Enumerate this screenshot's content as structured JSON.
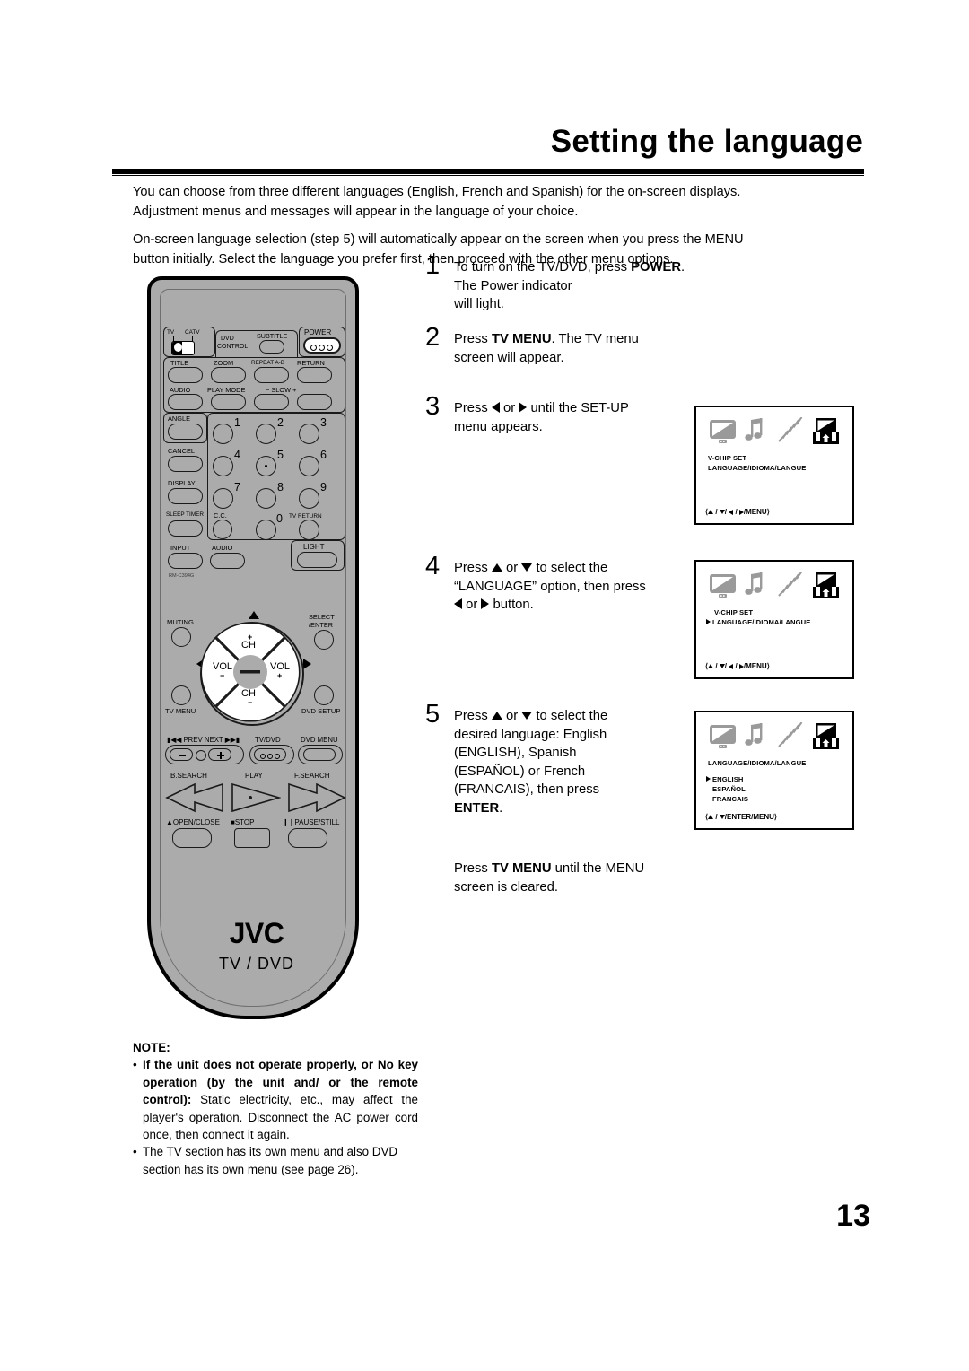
{
  "header": {
    "title": "Setting the language"
  },
  "intro": {
    "p1": "You can choose from three different languages (English, French and Spanish) for the on-screen displays.",
    "p2": "Adjustment menus and messages will appear in the language of your choice.",
    "p3": "On-screen language selection (step 5) will automatically appear on the screen when you press the MENU",
    "p4": "button initially. Select the language you prefer first, then proceed with the other menu options."
  },
  "steps": [
    {
      "num": "1",
      "t1": "To turn on the TV/DVD, press ",
      "b1": "POWER",
      "t2": ". The Power indicator",
      "t3": "will light."
    },
    {
      "num": "2",
      "t1": "Press ",
      "b1": "TV MENU",
      "t2": ". The TV menu",
      "t3": "screen will appear."
    },
    {
      "num": "3",
      "t1": "Press ",
      "t2": " or ",
      "t3": " until the SET-UP",
      "t4": "menu appears."
    },
    {
      "num": "4",
      "t1": "Press ",
      "t2": " or ",
      "t3": " to select the",
      "t4": "“LANGUAGE” option, then press",
      "t5": " or ",
      "t6": " button."
    },
    {
      "num": "5",
      "t1": "Press ",
      "t2": " or ",
      "t3": " to select the",
      "t4": "desired language: English",
      "t5": "(ENGLISH), Spanish",
      "t6": "(ESPAÑOL) or French",
      "t7": "(FRANCAIS), then press",
      "b1": "ENTER",
      "t8": "."
    }
  ],
  "closing": {
    "t1": "Press ",
    "b1": "TV MENU",
    "t2": " until the MENU",
    "t3": "screen is cleared."
  },
  "osd_screens": [
    {
      "id": "osd-setup-menu",
      "icons": [
        "tv-icon",
        "music-note-icon",
        "antenna-icon",
        "setup-box-icon"
      ],
      "lines": [
        {
          "text": "V-CHIP SET",
          "cursor": false
        },
        {
          "text": "LANGUAGE/IDIOMA/LANGUE",
          "cursor": false
        }
      ],
      "footer": "⟨▲ / ▼/ ◀ / ▶/MENU⟩",
      "footer_keys": [
        "up",
        "down",
        "left",
        "right",
        "MENU"
      ]
    },
    {
      "id": "osd-language-highlighted",
      "icons": [
        "tv-icon",
        "music-note-icon",
        "antenna-icon",
        "setup-box-icon"
      ],
      "lines": [
        {
          "text": "V-CHIP SET",
          "cursor": false
        },
        {
          "text": "LANGUAGE/IDIOMA/LANGUE",
          "cursor": true
        }
      ],
      "footer": "⟨▲ / ▼/ ◀ / ▶/MENU⟩",
      "footer_keys": [
        "up",
        "down",
        "left",
        "right",
        "MENU"
      ]
    },
    {
      "id": "osd-language-options",
      "icons": [
        "tv-icon",
        "music-note-icon",
        "antenna-icon",
        "setup-box-icon"
      ],
      "title": "LANGUAGE/IDIOMA/LANGUE",
      "options": [
        {
          "text": "ENGLISH",
          "cursor": true
        },
        {
          "text": "ESPAÑOL",
          "cursor": false
        },
        {
          "text": "FRANCAIS",
          "cursor": false
        }
      ],
      "footer": "⟨▲ / ▼/ENTER/MENU⟩",
      "footer_keys": [
        "up",
        "down",
        "ENTER",
        "MENU"
      ]
    }
  ],
  "remote": {
    "brand": "JVC",
    "subtitle": "TV / DVD",
    "model": "RM-C394G",
    "switch": {
      "left": "TV",
      "right": "CATV"
    },
    "dvd_control_label_l1": "DVD",
    "dvd_control_label_l2": "CONTROL",
    "subtitle_key": "SUBTITLE",
    "power_key": "POWER",
    "row_dvd_1": [
      "TITLE",
      "ZOOM",
      "REPEAT A-B",
      "RETURN"
    ],
    "row_dvd_2": [
      "AUDIO",
      "PLAY MODE",
      "−  SLOW  +"
    ],
    "left_column": [
      "ANGLE",
      "CANCEL",
      "DISPLAY",
      "SLEEP TIMER",
      "INPUT"
    ],
    "cc_key": "C.C.",
    "audio_key": "AUDIO",
    "light_key": "LIGHT",
    "numbers": [
      "1",
      "2",
      "3",
      "4",
      "5",
      "6",
      "7",
      "8",
      "9",
      "0"
    ],
    "tv_return": "TV RETURN",
    "muting": "MUTING",
    "select_enter_l1": "SELECT",
    "select_enter_l2": "/ENTER",
    "tv_menu": "TV MENU",
    "dvd_setup": "DVD SETUP",
    "ch_up": "CH",
    "ch_up_sign": "+",
    "ch_dn": "CH",
    "ch_dn_sign": "−",
    "vol_dn": "VOL",
    "vol_dn_sign": "−",
    "vol_up": "VOL",
    "vol_up_sign": "+",
    "prev": "PREV",
    "next": "NEXT",
    "tv_dvd": "TV/DVD",
    "dvd_menu": "DVD MENU",
    "b_search": "B.SEARCH",
    "play": "PLAY",
    "f_search": "F.SEARCH",
    "open_close": "OPEN/CLOSE",
    "stop": "STOP",
    "pause_still": "PAUSE/STILL"
  },
  "note": {
    "title": "NOTE:",
    "item1_bold": "If the unit does not operate properly, or No key operation (by the unit and/ or the remote control):",
    "item1_rest": " Static electricity, etc., may affect the player's operation. Disconnect the AC power cord once, then connect it again.",
    "item2": "The TV section has its own menu and also DVD section has its own menu (see page 26)."
  },
  "page_number": "13",
  "colors": {
    "remote_body": "#ababab",
    "osd_icon_inactive": "#9a9a9a",
    "osd_icon_active": "#000000"
  }
}
